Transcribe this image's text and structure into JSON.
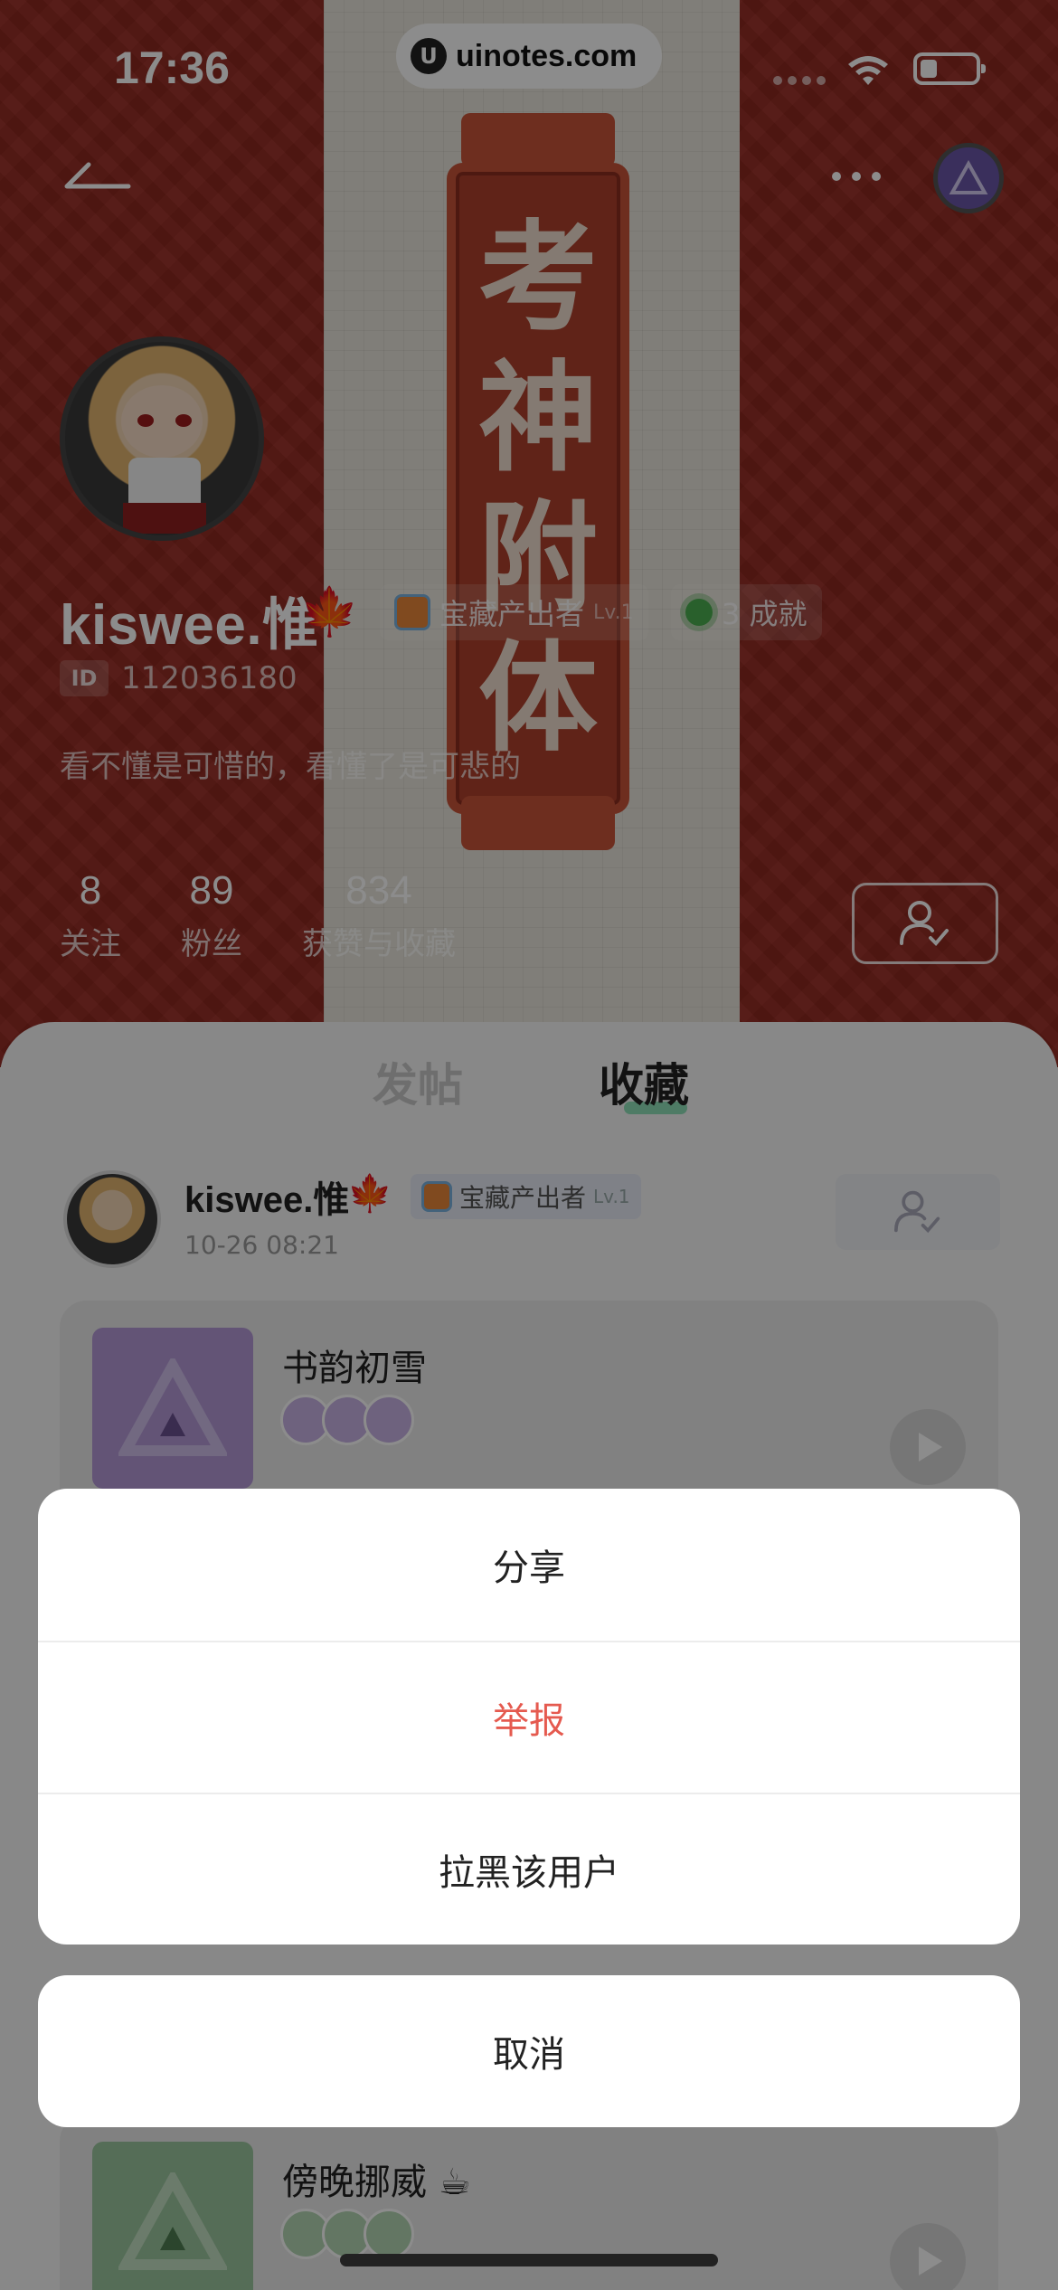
{
  "status_bar": {
    "time": "17:36",
    "url": "uinotes.com"
  },
  "cover": {
    "banner_chars": [
      "考",
      "神",
      "附",
      "体"
    ]
  },
  "profile": {
    "username": "kiswee.惟",
    "badges": [
      {
        "label": "宝藏产出者",
        "level": "Lv.1"
      },
      {
        "label": "3 成就"
      }
    ],
    "id_tag": "ID",
    "id_number": "112036180",
    "bio": "看不懂是可惜的，看懂了是可悲的",
    "stats": [
      {
        "value": "8",
        "label": "关注"
      },
      {
        "value": "89",
        "label": "粉丝"
      },
      {
        "value": "834",
        "label": "获赞与收藏"
      }
    ]
  },
  "tabs": [
    {
      "label": "发帖",
      "active": false
    },
    {
      "label": "收藏",
      "active": true
    }
  ],
  "post": {
    "author": "kiswee.惟",
    "badge_label": "宝藏产出者",
    "badge_level": "Lv.1",
    "time": "10-26 08:21"
  },
  "albums": [
    {
      "title": "书韵初雪",
      "cover_color": "#b59ad8",
      "icon_color": "#c9b3e6"
    },
    {
      "title": "傍晚挪威 ☕",
      "cover_color": "#9cc79f",
      "icon_color": "#b5d8b5"
    }
  ],
  "action_sheet": {
    "items": [
      {
        "label": "分享",
        "style": "normal"
      },
      {
        "label": "举报",
        "style": "danger"
      },
      {
        "label": "拉黑该用户",
        "style": "normal"
      }
    ],
    "cancel": "取消"
  },
  "colors": {
    "cover_background": "#9a2c23",
    "danger": "#e55a4f",
    "tab_accent": "#8ee1b8"
  },
  "icons": [
    "back-arrow-icon",
    "more-icon",
    "wifi-icon",
    "battery-icon",
    "follow-user-icon",
    "play-icon",
    "maple-leaf-icon"
  ]
}
